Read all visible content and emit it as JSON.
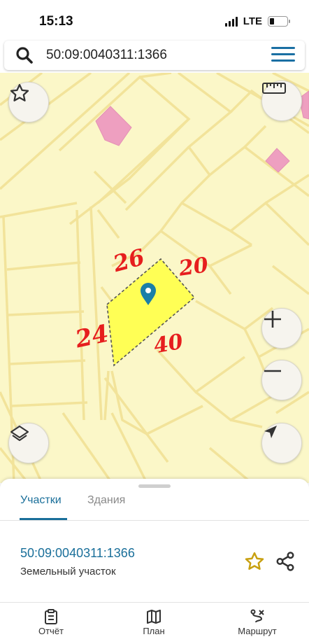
{
  "status": {
    "time": "15:13",
    "network": "LTE"
  },
  "search": {
    "query": "50:09:0040311:1366",
    "icon": "search-icon",
    "menu_icon": "hamburger-menu-icon"
  },
  "map": {
    "background_color": "#fbf7c8",
    "line_color": "#f2e39a",
    "parcel_fill": "#ffff55",
    "annotations": {
      "top": "26",
      "right": "20",
      "left": "24",
      "bottom": "40"
    },
    "marker_color": "#1a7fa8"
  },
  "controls": {
    "favorite": "star-icon",
    "ruler": "ruler-icon",
    "zoom_in": "plus-icon",
    "zoom_out": "minus-icon",
    "layers": "layers-icon",
    "locate": "navigation-arrow-icon"
  },
  "sheet": {
    "tabs": [
      {
        "label": "Участки",
        "active": true
      },
      {
        "label": "Здания",
        "active": false
      }
    ],
    "parcel_id": "50:09:0040311:1366",
    "parcel_type": "Земельный участок"
  },
  "bottom_nav": [
    {
      "label": "Отчёт",
      "icon": "report-icon"
    },
    {
      "label": "План",
      "icon": "map-plan-icon"
    },
    {
      "label": "Маршрут",
      "icon": "route-icon"
    }
  ]
}
